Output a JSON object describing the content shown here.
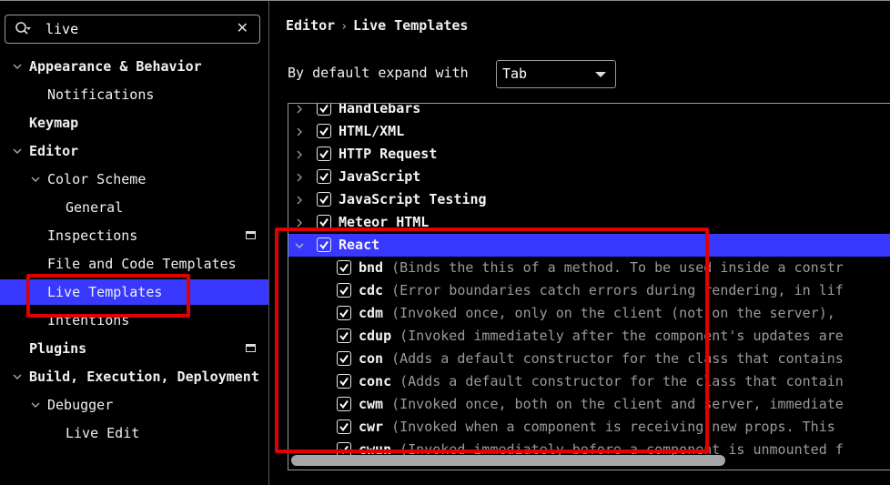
{
  "search": {
    "value": "live",
    "placeholder": ""
  },
  "sidebar": {
    "items": [
      {
        "label": "Appearance & Behavior",
        "level": 0,
        "expanded": true,
        "bold": true
      },
      {
        "label": "Notifications",
        "level": 1
      },
      {
        "label": "Keymap",
        "level": 0,
        "bold": true
      },
      {
        "label": "Editor",
        "level": 0,
        "expanded": true,
        "bold": true
      },
      {
        "label": "Color Scheme",
        "level": 1,
        "expanded": true
      },
      {
        "label": "General",
        "level": 2
      },
      {
        "label": "Inspections",
        "level": 1,
        "badge": true
      },
      {
        "label": "File and Code Templates",
        "level": 1
      },
      {
        "label": "Live Templates",
        "level": 1,
        "selected": true
      },
      {
        "label": "Intentions",
        "level": 1
      },
      {
        "label": "Plugins",
        "level": 0,
        "bold": true,
        "badge": true
      },
      {
        "label": "Build, Execution, Deployment",
        "level": 0,
        "expanded": true,
        "bold": true
      },
      {
        "label": "Debugger",
        "level": 1,
        "expanded": true
      },
      {
        "label": "Live Edit",
        "level": 2
      }
    ]
  },
  "breadcrumb": {
    "parent": "Editor",
    "separator": "›",
    "current": "Live Templates"
  },
  "expand": {
    "label": "By default expand with",
    "selected": "Tab"
  },
  "templates": {
    "groups": [
      {
        "name": "Handlebars",
        "checked": true,
        "expanded": false
      },
      {
        "name": "HTML/XML",
        "checked": true,
        "expanded": false
      },
      {
        "name": "HTTP Request",
        "checked": true,
        "expanded": false
      },
      {
        "name": "JavaScript",
        "checked": true,
        "expanded": false
      },
      {
        "name": "JavaScript Testing",
        "checked": true,
        "expanded": false
      },
      {
        "name": "Meteor HTML",
        "checked": true,
        "expanded": false
      },
      {
        "name": "React",
        "checked": true,
        "expanded": true,
        "selected": true
      }
    ],
    "react_items": [
      {
        "abbr": "bnd",
        "desc": "(Binds the this of a method. To be used inside a constr",
        "checked": true
      },
      {
        "abbr": "cdc",
        "desc": "(Error boundaries catch errors during rendering, in lif",
        "checked": true
      },
      {
        "abbr": "cdm",
        "desc": "(Invoked once, only on the client (not on the server),",
        "checked": true
      },
      {
        "abbr": "cdup",
        "desc": "(Invoked immediately after the component's updates are",
        "checked": true
      },
      {
        "abbr": "con",
        "desc": "(Adds a default constructor for the class that contains",
        "checked": true
      },
      {
        "abbr": "conc",
        "desc": "(Adds a default constructor for the class that contain",
        "checked": true
      },
      {
        "abbr": "cwm",
        "desc": "(Invoked once, both on the client and server, immediate",
        "checked": true
      },
      {
        "abbr": "cwr",
        "desc": "(Invoked when a component is receiving new props. This",
        "checked": true
      },
      {
        "abbr": "cwun",
        "desc": "(Invoked immediately before a component is unmounted f",
        "checked": true
      }
    ]
  },
  "colors": {
    "selection": "#3838ff",
    "highlight": "#e00000",
    "background": "#000000"
  }
}
